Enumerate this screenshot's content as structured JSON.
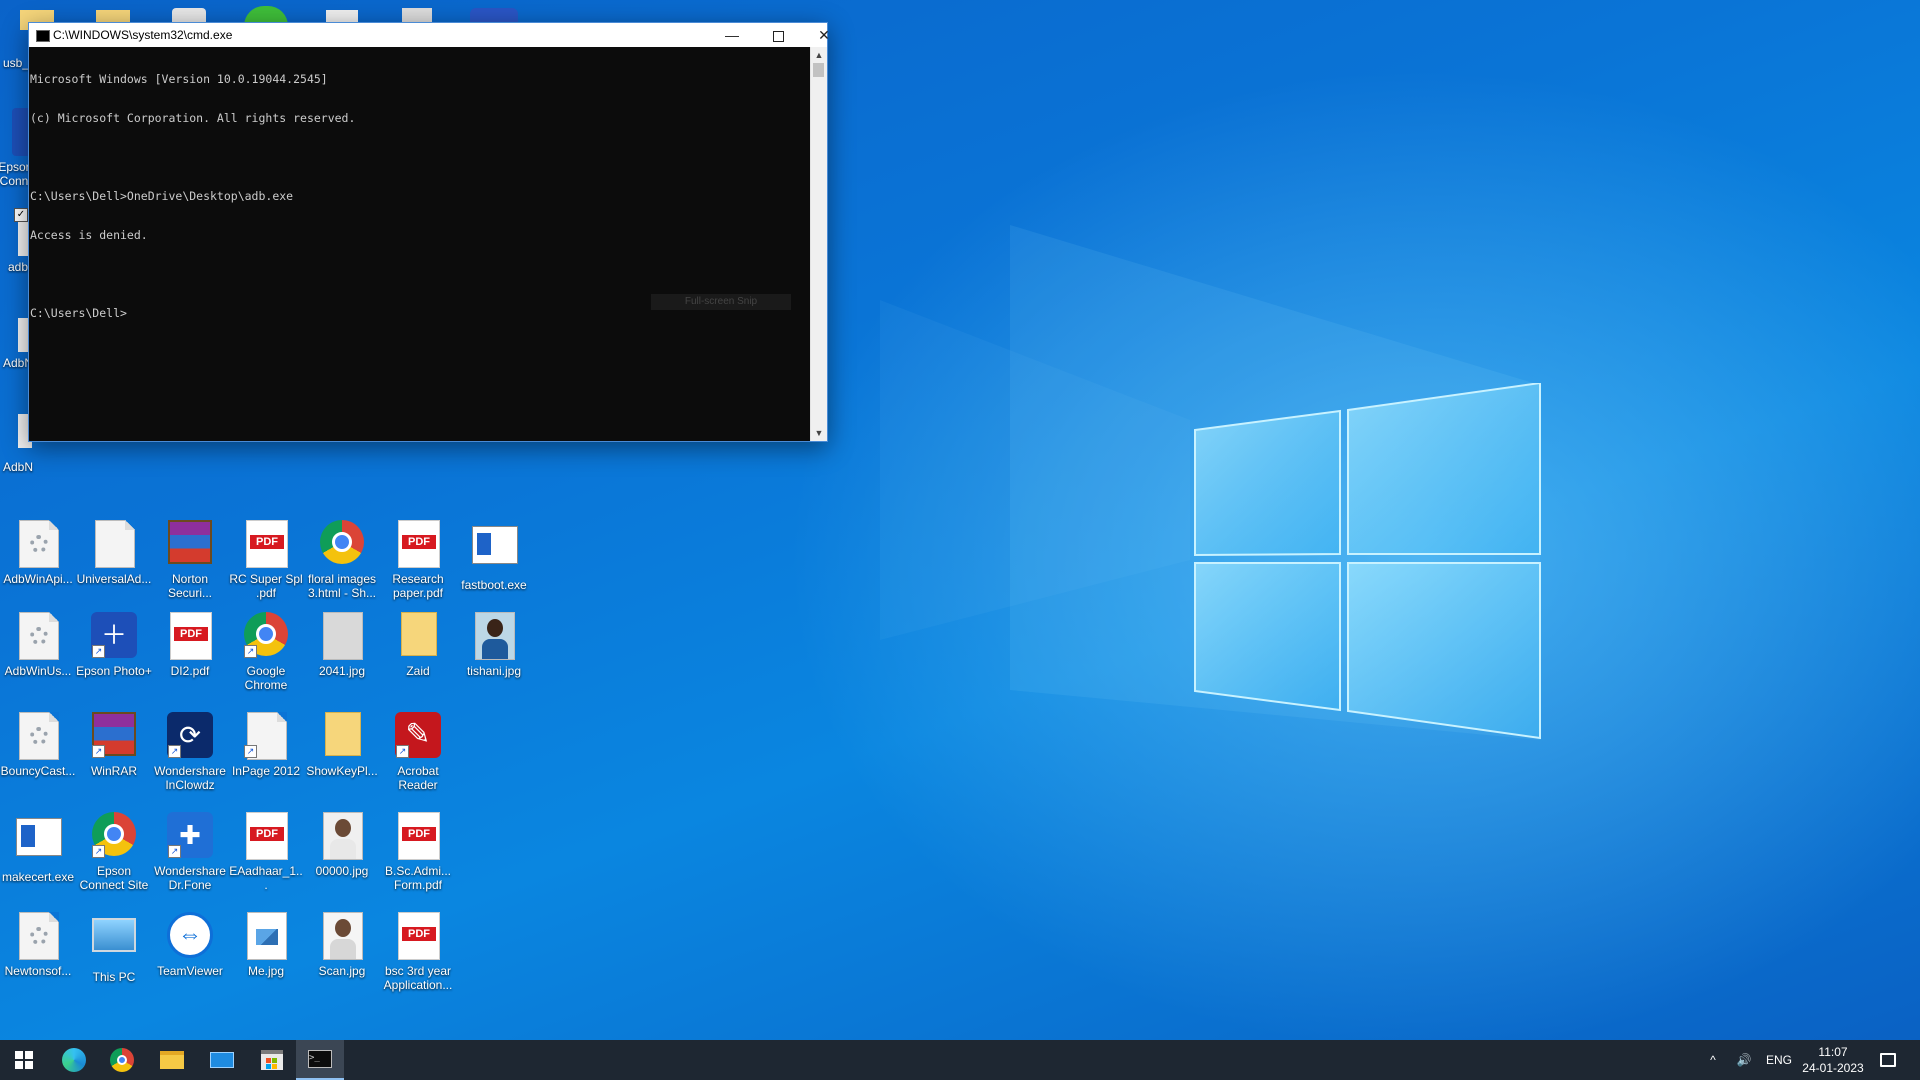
{
  "cmd_window": {
    "title": "C:\\WINDOWS\\system32\\cmd.exe",
    "minimize_icon": "minimize-icon",
    "maximize_icon": "maximize-icon",
    "close_icon": "close-icon",
    "lines": [
      "Microsoft Windows [Version 10.0.19044.2545]",
      "(c) Microsoft Corporation. All rights reserved.",
      "",
      "C:\\Users\\Dell>OneDrive\\Desktop\\adb.exe",
      "Access is denied.",
      "",
      "C:\\Users\\Dell>"
    ],
    "snip_overlay": "Full-screen Snip"
  },
  "desktop": {
    "partial_left_labels": [
      "usb_",
      "Epsor",
      "Conn",
      "adb",
      "AdbN",
      "AdbN"
    ],
    "icons_row1": [
      "AdbWinApi...",
      "UniversalAd...",
      "Norton Securi...",
      "RC Super Spl .pdf",
      "floral images 3.html - Sh...",
      "Research paper.pdf",
      "fastboot.exe"
    ],
    "icons_row2": [
      "AdbWinUs...",
      "Epson Photo+",
      "DI2.pdf",
      "Google Chrome",
      "2041.jpg",
      "Zaid",
      "tishani.jpg"
    ],
    "icons_row3": [
      "BouncyCast...",
      "WinRAR",
      "Wondershare InClowdz",
      "InPage 2012",
      "ShowKeyPl...",
      "Acrobat Reader"
    ],
    "icons_row4": [
      "makecert.exe",
      "Epson Connect Site",
      "Wondershare Dr.Fone",
      "EAadhaar_1...",
      "00000.jpg",
      "B.Sc.Admi... Form.pdf"
    ],
    "icons_row5": [
      "Newtonsof...",
      "This PC",
      "TeamViewer",
      "Me.jpg",
      "Scan.jpg",
      "bsc 3rd year Application..."
    ],
    "pdf_badge": "PDF"
  },
  "taskbar": {
    "apps": [
      "start-icon",
      "edge-icon",
      "chrome-icon",
      "file-explorer-icon",
      "mail-icon",
      "store-icon",
      "cmd-icon"
    ],
    "tray": {
      "chevron": "^",
      "volume": "🔊",
      "language": "ENG",
      "time": "11:07",
      "date": "24-01-2023"
    }
  },
  "colors": {
    "desktop_blue": "#0a74d6",
    "console_bg": "#0c0c0c",
    "console_text": "#cccccc",
    "taskbar_bg": "#1e2732"
  }
}
